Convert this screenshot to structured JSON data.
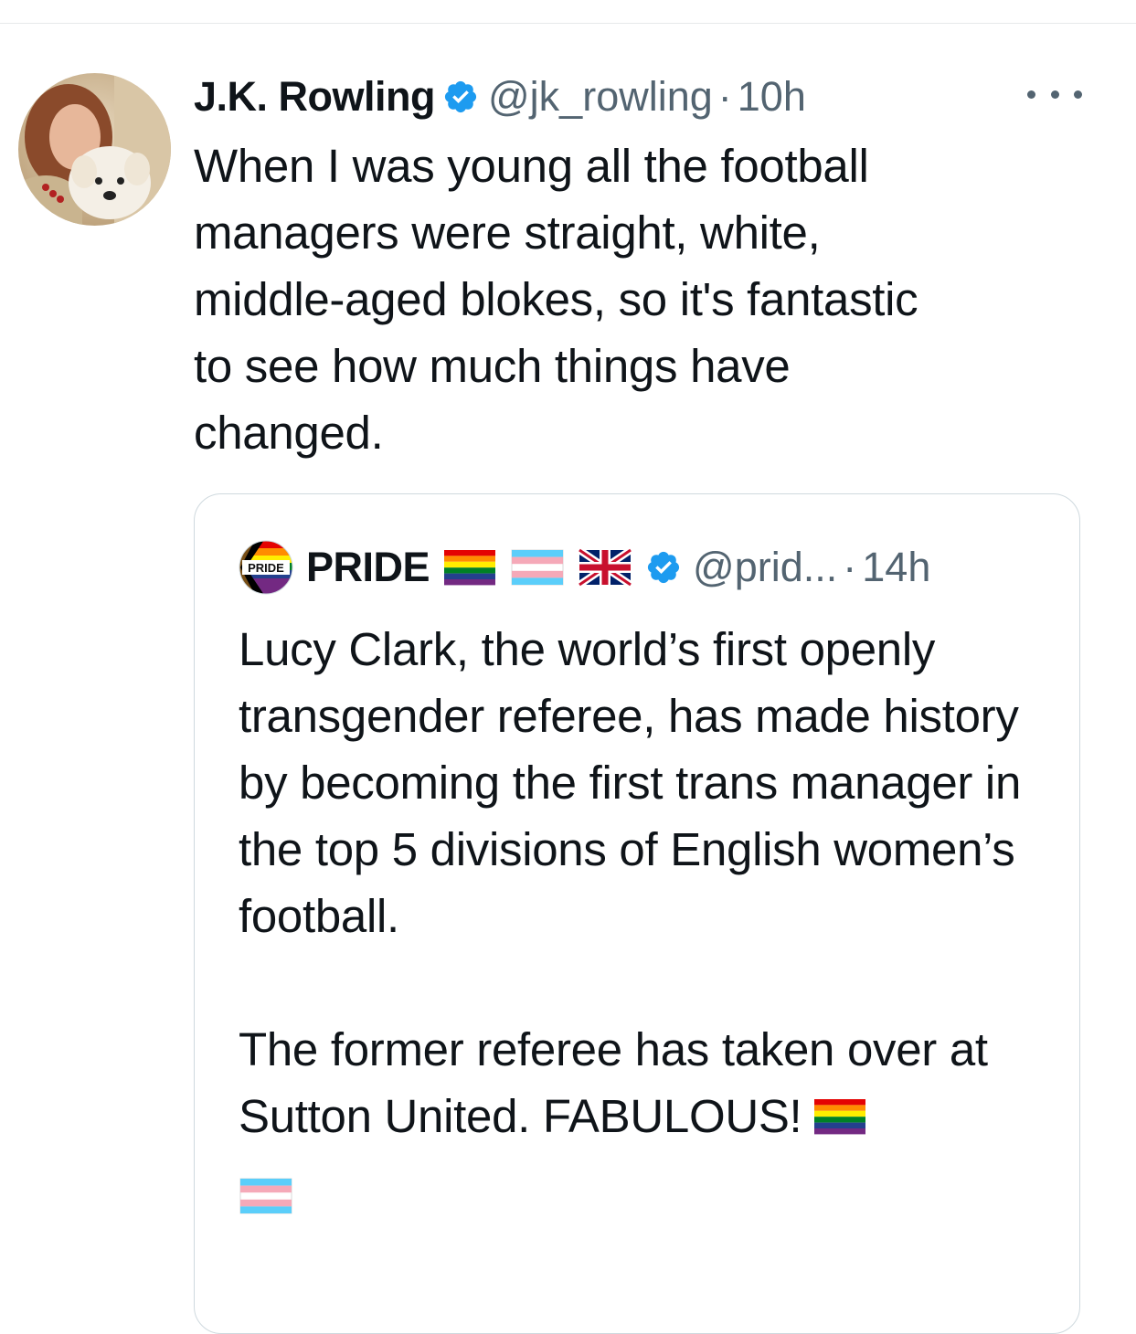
{
  "tweet": {
    "author": {
      "display_name": "J.K. Rowling",
      "handle": "@jk_rowling",
      "verified": true
    },
    "separator": "·",
    "time": "10h",
    "text": "When I was young all the football\nmanagers were straight, white,\nmiddle-aged blokes, so it's fantastic\nto see how much things have\nchanged."
  },
  "quoted_tweet": {
    "author": {
      "display_name": "PRIDE",
      "handle": "@prid...",
      "verified": true,
      "avatar_label": "PRIDE",
      "name_flags": [
        "rainbow-flag-icon",
        "transgender-flag-icon",
        "uk-flag-icon"
      ]
    },
    "separator": "·",
    "time": "14h",
    "paragraph_1": "Lucy Clark, the world’s first openly transgender referee, has made history by becoming the first trans manager in the top 5 divisions of English women’s football.",
    "paragraph_2": "The former referee has taken over at Sutton United. FABULOUS!",
    "trailing_flags": [
      "rainbow-flag-icon",
      "transgender-flag-icon"
    ]
  },
  "colors": {
    "text_primary": "#0f1419",
    "text_secondary": "#536471",
    "verified_blue": "#1d9bf0",
    "border": "#cfd9de"
  }
}
